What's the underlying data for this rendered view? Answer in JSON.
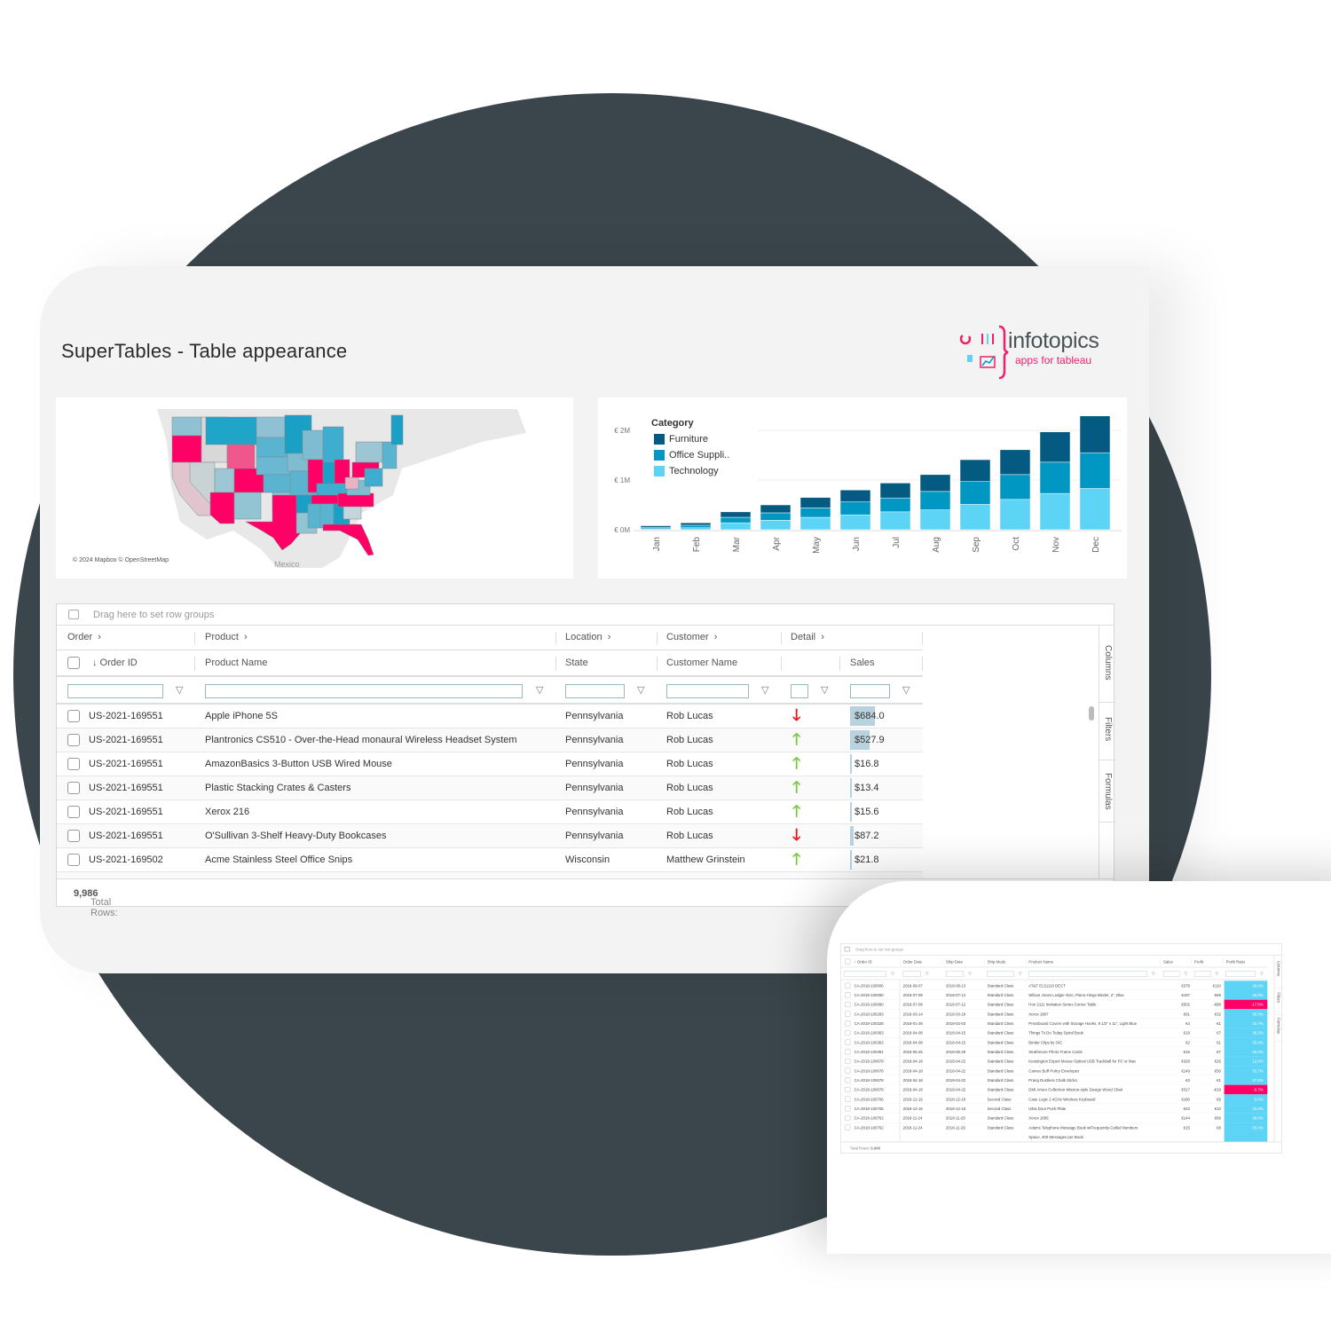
{
  "title": "SuperTables - Table appearance",
  "logo": {
    "brand": "infotopics",
    "tagline": "apps for tableau"
  },
  "colors": {
    "background_blob": "#3a464c",
    "accent_pink": "#ff0066",
    "furniture": "#045a80",
    "office_supplies": "#0097c3",
    "technology": "#5dd3f5",
    "trend_up": "#7ac943",
    "trend_down": "#ee1111",
    "sales_bar": "#b8d3de"
  },
  "map": {
    "attribution": "© 2024 Mapbox © OpenStreetMap",
    "label_mexico": "Mexico"
  },
  "chart_data": {
    "type": "bar",
    "stacked": true,
    "categories": [
      "Jan",
      "Feb",
      "Mar",
      "Apr",
      "May",
      "Jun",
      "Jul",
      "Aug",
      "Sep",
      "Oct",
      "Nov",
      "Dec"
    ],
    "series": [
      {
        "name": "Furniture",
        "values": [
          0.03,
          0.05,
          0.11,
          0.16,
          0.21,
          0.24,
          0.3,
          0.34,
          0.44,
          0.5,
          0.61,
          0.74
        ]
      },
      {
        "name": "Office Suppli..",
        "values": [
          0.03,
          0.05,
          0.11,
          0.15,
          0.19,
          0.26,
          0.28,
          0.37,
          0.46,
          0.5,
          0.63,
          0.72
        ]
      },
      {
        "name": "Technology",
        "values": [
          0.02,
          0.04,
          0.14,
          0.19,
          0.25,
          0.3,
          0.36,
          0.4,
          0.51,
          0.61,
          0.73,
          0.83
        ]
      }
    ],
    "legend_title": "Category",
    "legend_position": "top-left",
    "y_ticks": [
      "€ 0M",
      "€ 1M",
      "€ 2M"
    ],
    "ylim": [
      0,
      2.4
    ],
    "yunit": "€M",
    "grid": true
  },
  "table": {
    "drag_hint": "Drag here to set row groups",
    "groups": [
      {
        "label": "Order"
      },
      {
        "label": "Product"
      },
      {
        "label": "Location"
      },
      {
        "label": "Customer"
      },
      {
        "label": "Detail"
      }
    ],
    "columns": {
      "order_id": "↓ Order ID",
      "product_name": "Product Name",
      "state": "State",
      "customer_name": "Customer Name",
      "sales": "Sales"
    },
    "rows": [
      {
        "order_id": "US-2021-169551",
        "product": "Apple iPhone 5S",
        "state": "Pennsylvania",
        "customer": "Rob Lucas",
        "trend": "down",
        "sales": "$684.0",
        "sales_value": 684.0
      },
      {
        "order_id": "US-2021-169551",
        "product": "Plantronics CS510 - Over-the-Head monaural Wireless Headset System",
        "state": "Pennsylvania",
        "customer": "Rob Lucas",
        "trend": "up",
        "sales": "$527.9",
        "sales_value": 527.9
      },
      {
        "order_id": "US-2021-169551",
        "product": "AmazonBasics 3-Button USB Wired Mouse",
        "state": "Pennsylvania",
        "customer": "Rob Lucas",
        "trend": "up",
        "sales": "$16.8",
        "sales_value": 16.8
      },
      {
        "order_id": "US-2021-169551",
        "product": "Plastic Stacking Crates & Casters",
        "state": "Pennsylvania",
        "customer": "Rob Lucas",
        "trend": "up",
        "sales": "$13.4",
        "sales_value": 13.4
      },
      {
        "order_id": "US-2021-169551",
        "product": "Xerox 216",
        "state": "Pennsylvania",
        "customer": "Rob Lucas",
        "trend": "up",
        "sales": "$15.6",
        "sales_value": 15.6
      },
      {
        "order_id": "US-2021-169551",
        "product": "O'Sullivan 3-Shelf Heavy-Duty Bookcases",
        "state": "Pennsylvania",
        "customer": "Rob Lucas",
        "trend": "down",
        "sales": "$87.2",
        "sales_value": 87.2
      },
      {
        "order_id": "US-2021-169502",
        "product": "Acme Stainless Steel Office Snips",
        "state": "Wisconsin",
        "customer": "Matthew Grinstein",
        "trend": "up",
        "sales": "$21.8",
        "sales_value": 21.8
      }
    ],
    "footer_label": "Total Rows:",
    "footer_count": "9,986",
    "side_tabs": [
      "Columns",
      "Filters",
      "Formulas"
    ]
  },
  "mini_table": {
    "drag_hint": "Drag here to set row groups",
    "columns": [
      "↑ Order ID",
      "Order Date",
      "Ship Date",
      "Ship Mode",
      "Product Name",
      "Sales",
      "Profit",
      "Profit Ratio"
    ],
    "rows": [
      {
        "id": "CA-2018-100006",
        "od": "2018-09-07",
        "sd": "2018-09-13",
        "mode": "Standard Class",
        "product": "AT&T EL51110 DECT",
        "sales": "€378",
        "profit": "€110",
        "ratio": "29.0%",
        "negative": false
      },
      {
        "id": "CA-2018-100090",
        "od": "2018-07-08",
        "sd": "2018-07-12",
        "mode": "Standard Class",
        "product": "Wilson Jones Ledger-Size, Piano-Hinge Binder, 2\", Blue",
        "sales": "€197",
        "profit": "€69",
        "ratio": "35.0%",
        "negative": false
      },
      {
        "id": "CA-2018-100090",
        "od": "2018-07-08",
        "sd": "2018-07-12",
        "mode": "Standard Class",
        "product": "Hon 2111 Invitation Series Corner Table",
        "sales": "€502",
        "profit": "-€88",
        "ratio": "-17.5%",
        "negative": true
      },
      {
        "id": "CA-2018-100293",
        "od": "2018-03-14",
        "sd": "2018-03-18",
        "mode": "Standard Class",
        "product": "Xerox 1887",
        "sales": "€91",
        "profit": "€32",
        "ratio": "35.0%",
        "negative": false
      },
      {
        "id": "CA-2018-100328",
        "od": "2018-01-28",
        "sd": "2018-02-03",
        "mode": "Standard Class",
        "product": "Pressboard Covers with Storage Hooks, 9 1/2\" x 11\", Light Blue",
        "sales": "€4",
        "profit": "€1",
        "ratio": "33.7%",
        "negative": false
      },
      {
        "id": "CA-2018-100363",
        "od": "2018-04-08",
        "sd": "2018-04-15",
        "mode": "Standard Class",
        "product": "Things To Do Today Spiral Book",
        "sales": "€19",
        "profit": "€7",
        "ratio": "36.2%",
        "negative": false
      },
      {
        "id": "CA-2018-100363",
        "od": "2018-04-08",
        "sd": "2018-04-15",
        "mode": "Standard Class",
        "product": "Binder Clips by OIC",
        "sales": "€2",
        "profit": "€1",
        "ratio": "35.0%",
        "negative": false
      },
      {
        "id": "CA-2018-100391",
        "od": "2018-05-25",
        "sd": "2018-05-29",
        "mode": "Standard Class",
        "product": "Strathmore Photo Frame Cards",
        "sales": "€15",
        "profit": "€7",
        "ratio": "46.0%",
        "negative": false
      },
      {
        "id": "CA-2018-100678",
        "od": "2018-04-18",
        "sd": "2018-04-22",
        "mode": "Standard Class",
        "product": "Kensington Expert Mouse Optical USB Trackball for PC or Mac",
        "sales": "€328",
        "profit": "€26",
        "ratio": "12.0%",
        "negative": false
      },
      {
        "id": "CA-2018-100678",
        "od": "2018-04-18",
        "sd": "2018-04-22",
        "mode": "Standard Class",
        "product": "Cameo Buff Policy Envelopes",
        "sales": "€149",
        "profit": "€50",
        "ratio": "33.7%",
        "negative": false
      },
      {
        "id": "CA-2018-100678",
        "od": "2018-04-18",
        "sd": "2018-04-22",
        "mode": "Standard Class",
        "product": "Prang Dustless Chalk Sticks",
        "sales": "€3",
        "profit": "€1",
        "ratio": "37.5%",
        "negative": false
      },
      {
        "id": "CA-2018-100678",
        "od": "2018-04-18",
        "sd": "2018-04-22",
        "mode": "Standard Class",
        "product": "DMI Arturo Collection Mission-style Design Wood Chair",
        "sales": "€317",
        "profit": "-€18",
        "ratio": "-5.7%",
        "negative": true
      },
      {
        "id": "CA-2018-100706",
        "od": "2018-12-16",
        "sd": "2018-12-18",
        "mode": "Second Class",
        "product": "Case Logic 2.4GHz Wireless Keyboard",
        "sales": "€180",
        "profit": "€9",
        "ratio": "5.0%",
        "negative": false
      },
      {
        "id": "CA-2018-100706",
        "od": "2018-12-16",
        "sd": "2018-12-18",
        "mode": "Second Class",
        "product": "Ultra Door Push Plate",
        "sales": "€23",
        "profit": "€10",
        "ratio": "33.0%",
        "negative": false
      },
      {
        "id": "CA-2018-100762",
        "od": "2018-11-24",
        "sd": "2018-11-29",
        "mode": "Standard Class",
        "product": "Xerox 1885",
        "sales": "€144",
        "profit": "€69",
        "ratio": "48.0%",
        "negative": false
      },
      {
        "id": "CA-2018-100762",
        "od": "2018-11-24",
        "sd": "2018-11-29",
        "mode": "Standard Class",
        "product": "Adams Telephone Message Book w/Frequently-Called Numbers",
        "product_line2": "Space, 400 Messages per Book",
        "sales": "€15",
        "profit": "€8",
        "ratio": "50.0%",
        "negative": false
      }
    ],
    "footer_label": "Total Rows:",
    "footer_count": "9,986",
    "side_tabs": [
      "Columns",
      "Filters",
      "Formulas"
    ]
  }
}
